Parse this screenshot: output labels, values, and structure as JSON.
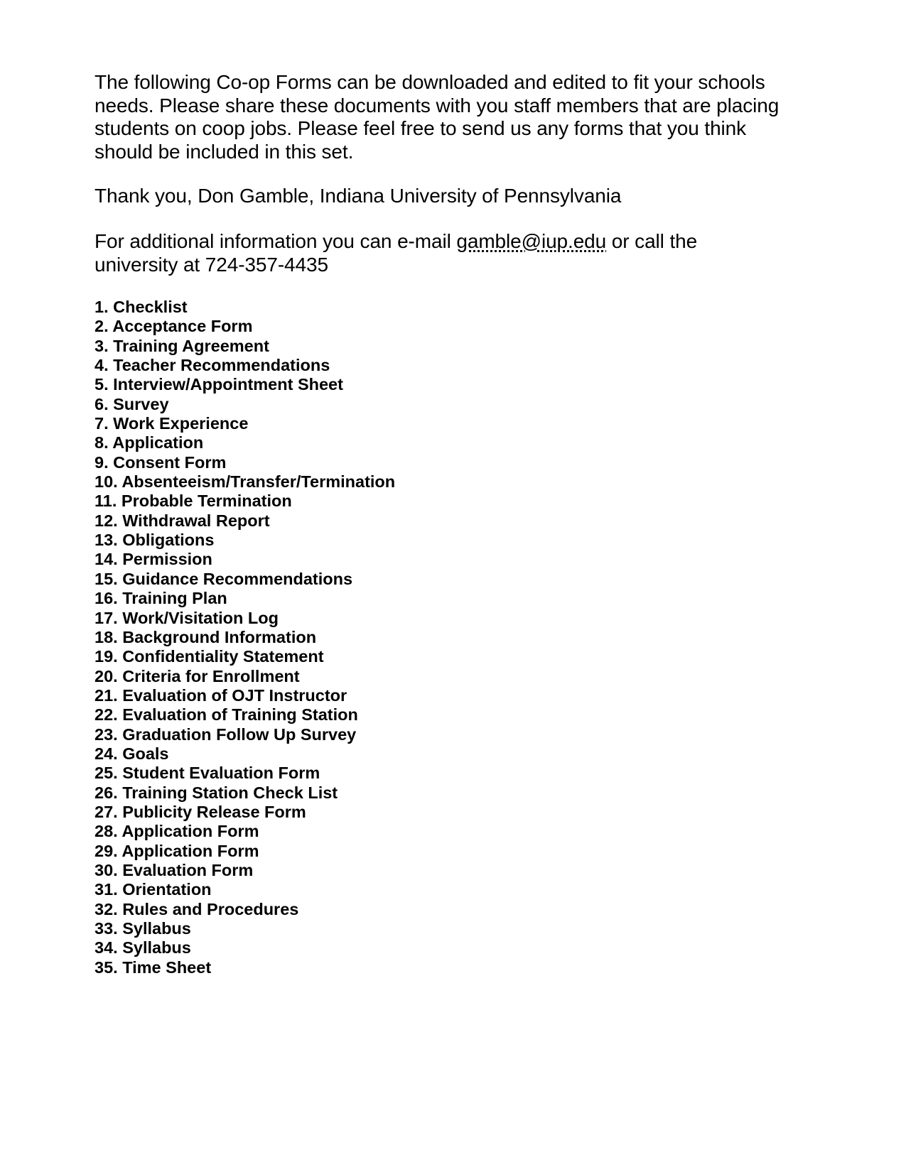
{
  "intro": "The following Co-op Forms can be downloaded and edited to fit your schools needs. Please share these documents with you staff members that are placing students on coop jobs. Please feel free to send us any forms that you think should be included in this set.",
  "thanks": "Thank you, Don Gamble, Indiana University of Pennsylvania",
  "contact": {
    "prefix": "For additional information you can e-mail ",
    "email": "gamble@iup.edu",
    "suffix": " or call the university at 724-357-4435"
  },
  "forms": [
    "1. Checklist",
    "2. Acceptance Form",
    "3. Training Agreement",
    "4. Teacher Recommendations",
    "5. Interview/Appointment Sheet",
    "6. Survey",
    "7. Work Experience",
    "8. Application",
    "9. Consent Form",
    "10. Absenteeism/Transfer/Termination",
    "11. Probable Termination",
    "12. Withdrawal Report",
    "13. Obligations",
    "14. Permission",
    "15. Guidance Recommendations",
    "16. Training Plan",
    "17. Work/Visitation Log",
    "18. Background Information",
    "19. Confidentiality Statement",
    "20. Criteria for Enrollment",
    "21. Evaluation of OJT Instructor",
    "22. Evaluation of Training Station",
    "23. Graduation Follow Up Survey",
    "24. Goals",
    "25. Student Evaluation Form",
    "26. Training Station Check List",
    "27. Publicity Release Form",
    "28. Application Form",
    "29. Application Form",
    "30. Evaluation Form",
    "31. Orientation",
    "32. Rules and Procedures",
    "33. Syllabus",
    "34. Syllabus",
    "35. Time Sheet"
  ]
}
